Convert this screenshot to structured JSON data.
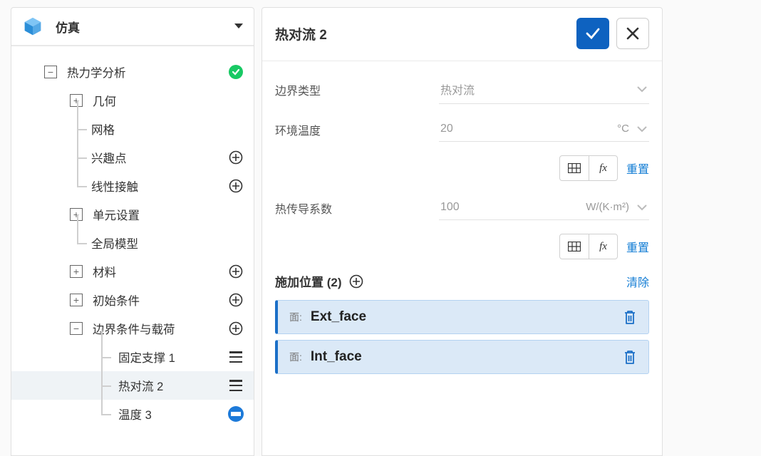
{
  "sidebar": {
    "title": "仿真",
    "root": {
      "label": "热力学分析"
    },
    "nodes": {
      "geometry": "几何",
      "mesh": "网格",
      "poi": "兴趣点",
      "contact": "线性接触",
      "element": "单元设置",
      "globalModel": "全局模型",
      "material": "材料",
      "initial": "初始条件",
      "bc": "边界条件与载荷",
      "fixed": "固定支撑 1",
      "convection": "热对流 2",
      "temperature": "温度 3"
    }
  },
  "panel": {
    "title": "热对流 2",
    "fields": {
      "boundaryTypeLabel": "边界类型",
      "boundaryTypeValue": "热对流",
      "ambientLabel": "环境温度",
      "ambientValue": "20",
      "ambientUnit": "°C",
      "coeffLabel": "热传导系数",
      "coeffValue": "100",
      "coeffUnit": "W/(K·m²)"
    },
    "resetLabel": "重置",
    "assign": {
      "titlePrefix": "施加位置",
      "count": "(2)",
      "clear": "清除",
      "facePrefix": "面:",
      "items": [
        "Ext_face",
        "Int_face"
      ]
    }
  }
}
